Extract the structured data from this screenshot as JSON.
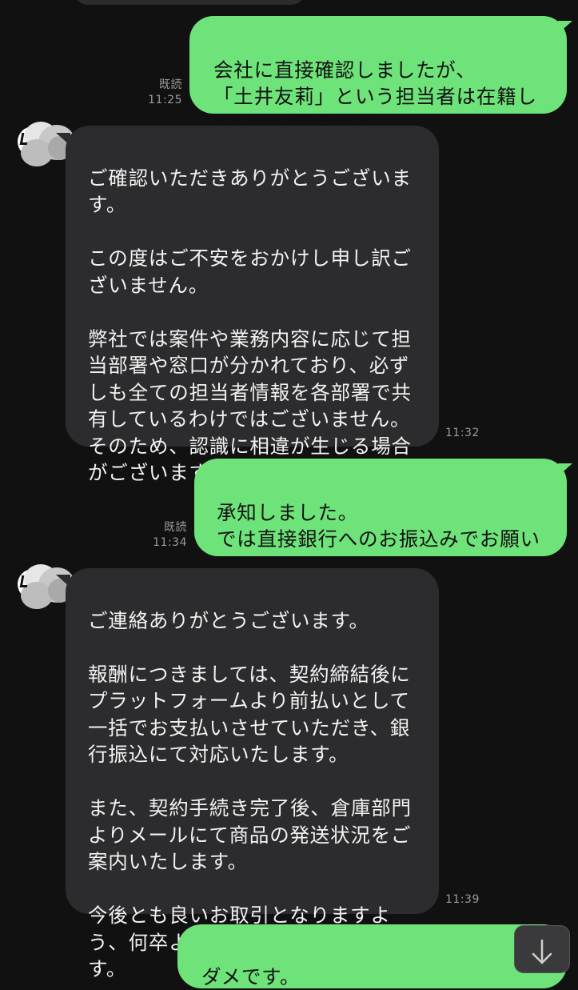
{
  "messages": [
    {
      "from": "me",
      "text": "会社に直接確認しましたが、\n「土井友莉」という担当者は在籍していないそうです。",
      "read": "既読",
      "time": "11:25"
    },
    {
      "from": "them",
      "text": "ご確認いただきありがとうございます。\n\nこの度はご不安をおかけし申し訳ございません。\n\n弊社では案件や業務内容に応じて担当部署や窓口が分かれており、必ずしも全ての担当者情報を各部署で共有しているわけではございません。そのため、認識に相違が生じる場合がございます。",
      "time": "11:32"
    },
    {
      "from": "me",
      "text": "承知しました。\nでは直接銀行へのお振込みでお願いします。",
      "read": "既読",
      "time": "11:34"
    },
    {
      "from": "them",
      "text": "ご連絡ありがとうございます。\n\n報酬につきましては、契約締結後にプラットフォームより前払いとして一括でお支払いさせていただき、銀行振込にて対応いたします。\n\nまた、契約手続き完了後、倉庫部門よりメールにて商品の発送状況をご案内いたします。\n\n今後とも良いお取引となりますよう、何卒よろしくお願い申し上げます。",
      "time": "11:39"
    },
    {
      "from": "me",
      "text": "ダメです。"
    }
  ],
  "colors": {
    "background": "#111111",
    "outgoing_bubble": "#6ee37a",
    "incoming_bubble": "#2c2c2e",
    "meta_text": "#9a9a9a"
  },
  "icons": {
    "scroll_down": "arrow-down-icon",
    "avatar": "blurred-avatar"
  }
}
